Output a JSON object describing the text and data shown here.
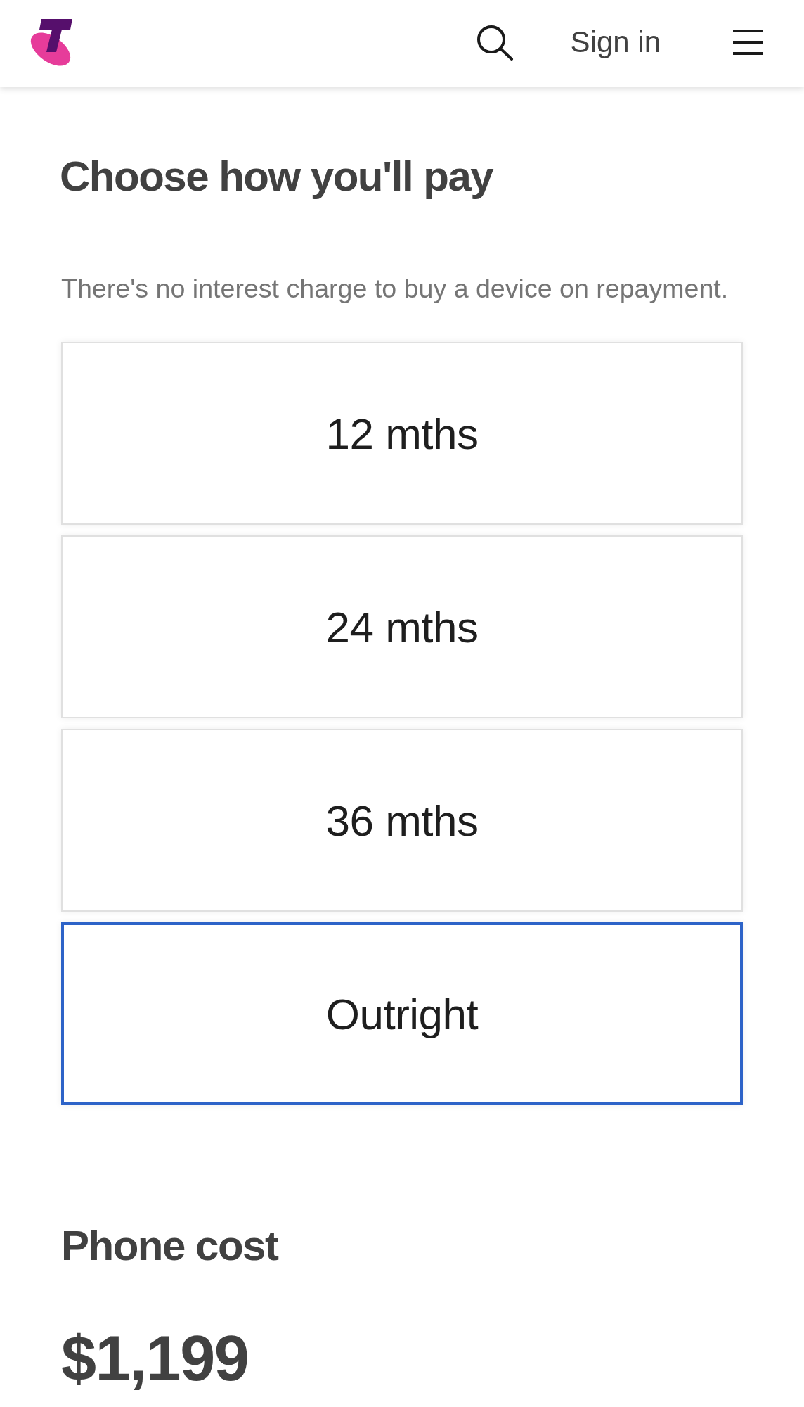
{
  "header": {
    "sign_in": "Sign in"
  },
  "title": "Choose how you'll pay",
  "subtitle": "There's no interest charge to buy a device on repayment.",
  "payment_options": [
    {
      "label": "12 mths",
      "selected": false
    },
    {
      "label": "24 mths",
      "selected": false
    },
    {
      "label": "36 mths",
      "selected": false
    },
    {
      "label": "Outright",
      "selected": true
    }
  ],
  "phone_cost": {
    "heading": "Phone cost",
    "price": "$1,199"
  }
}
